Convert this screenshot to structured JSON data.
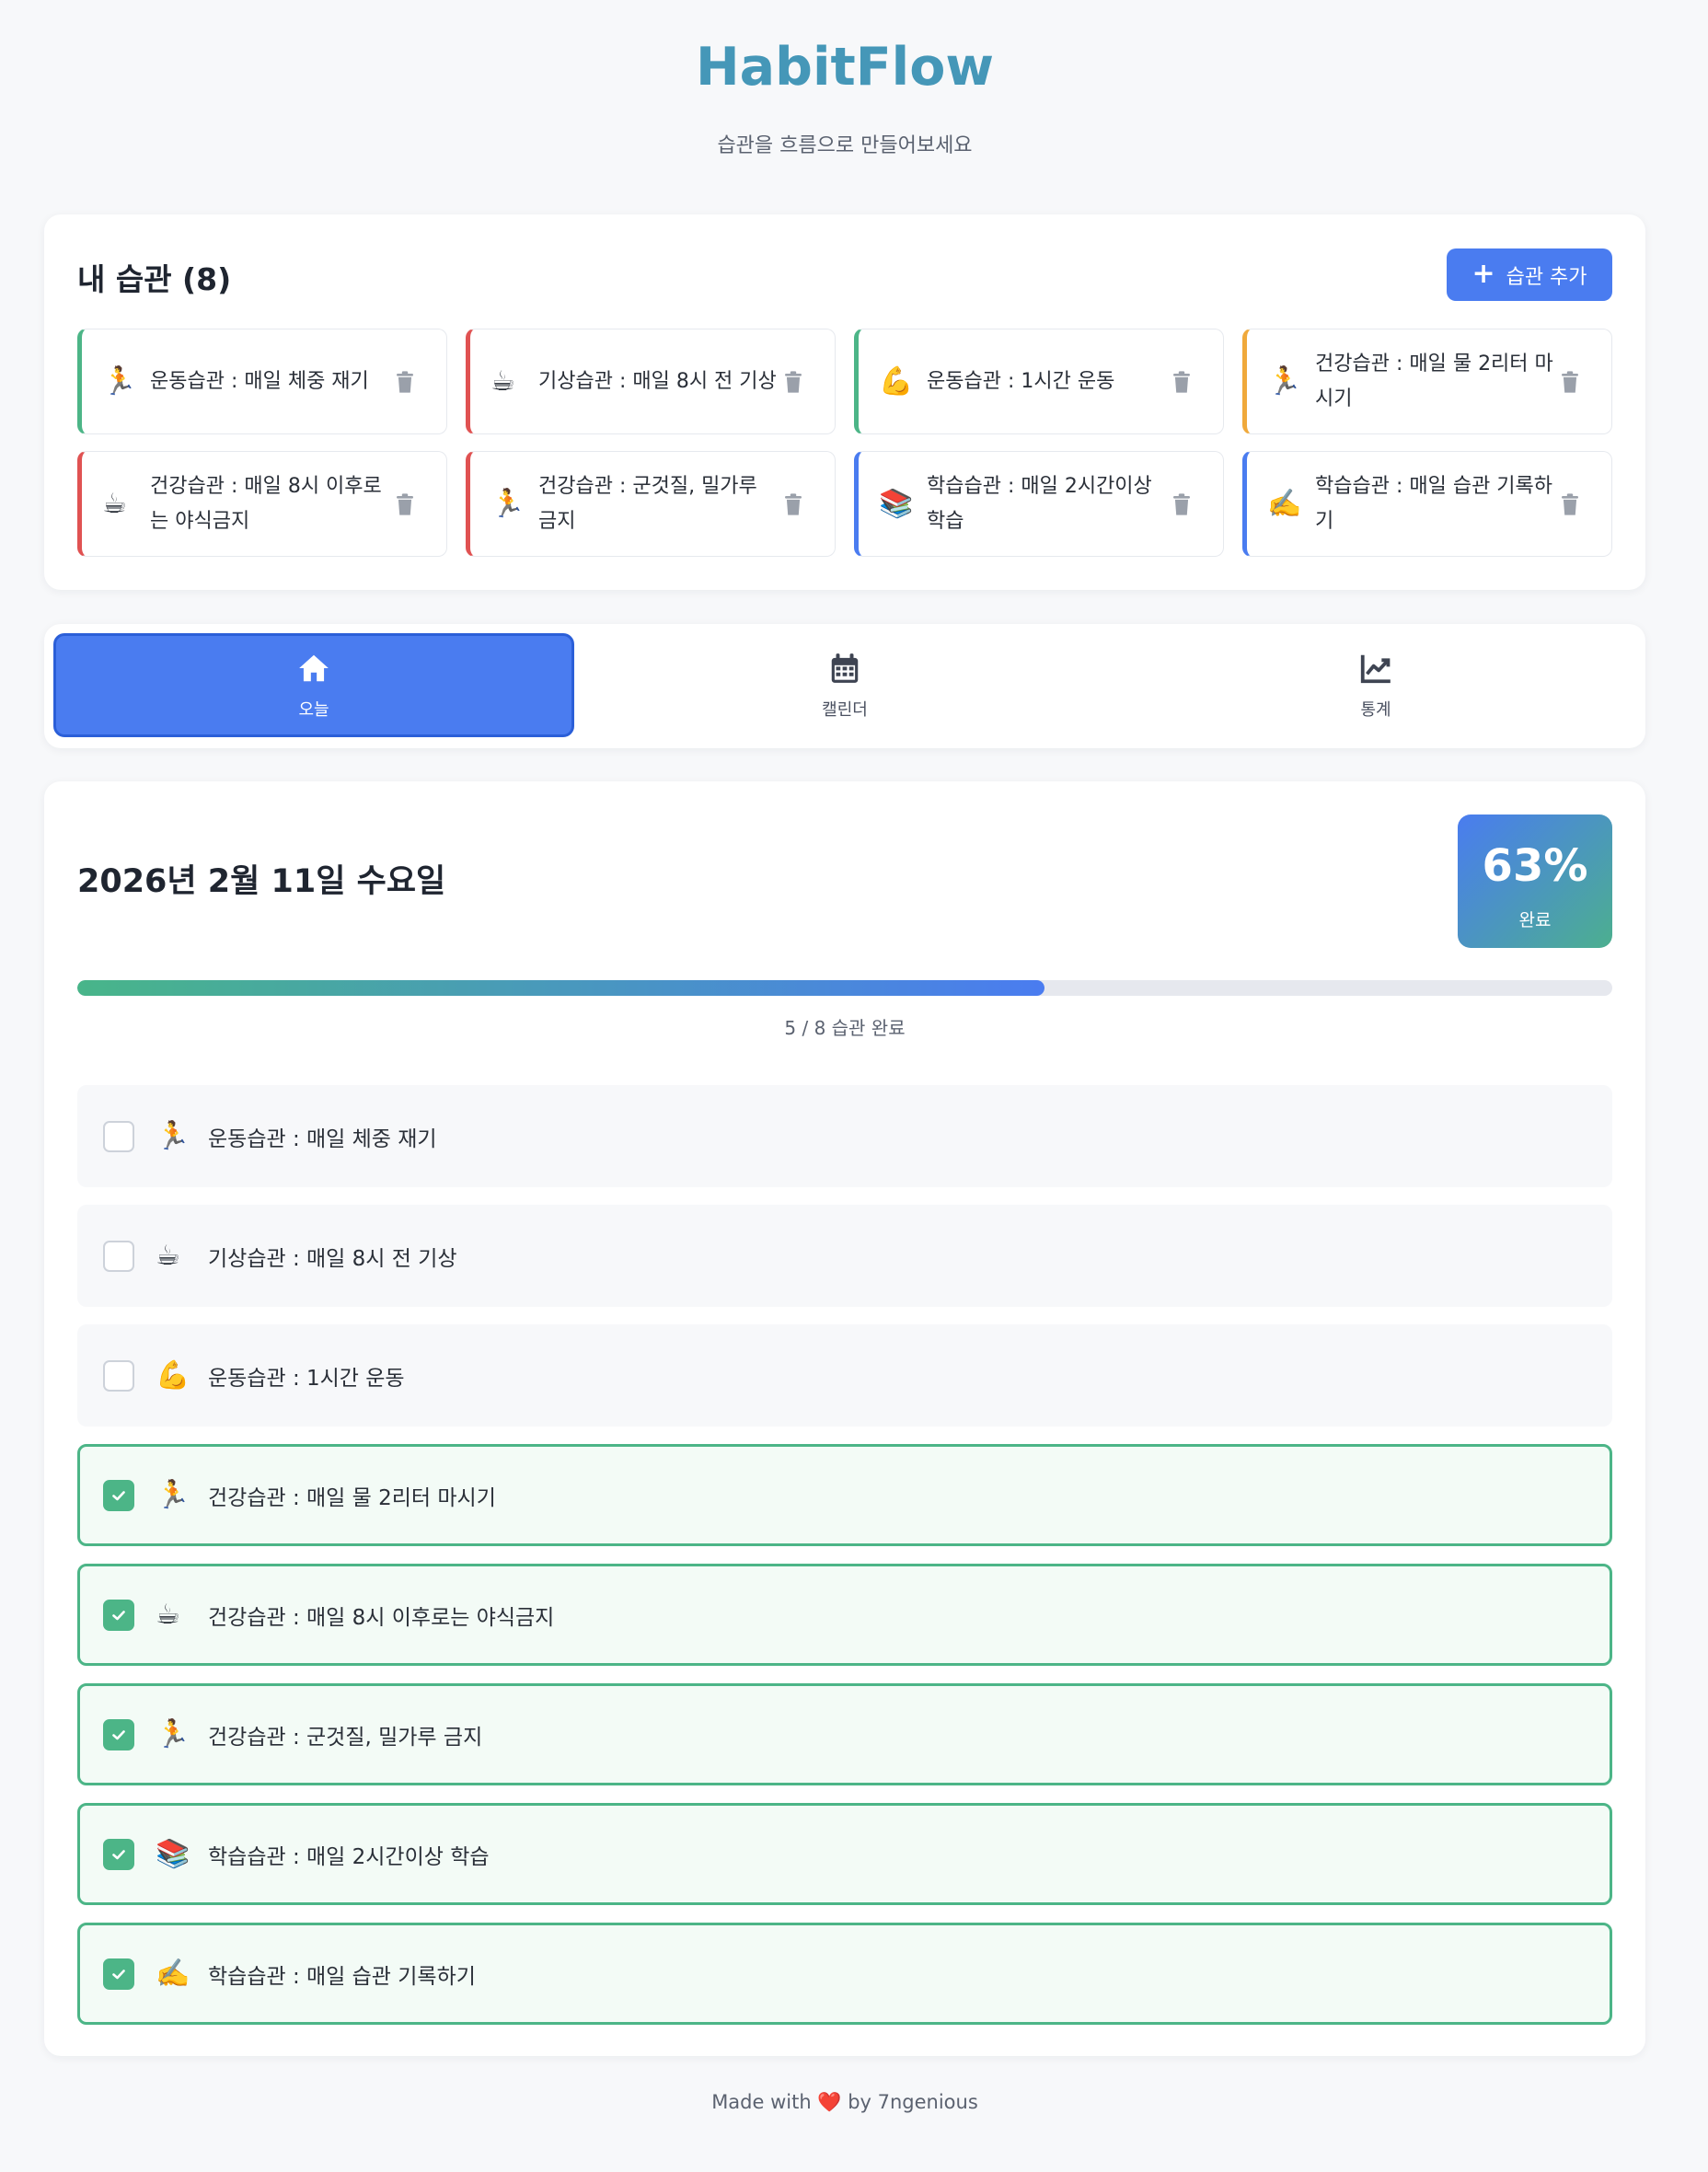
{
  "app": {
    "title": "HabitFlow",
    "subtitle": "습관을 흐름으로 만들어보세요"
  },
  "habits": {
    "title": "내 습관 (8)",
    "add_label": "습관 추가",
    "items": [
      {
        "emoji": "🏃",
        "name": "운동습관 : 매일 체중 재기",
        "color": "#4cb587"
      },
      {
        "emoji": "☕",
        "name": "기상습관 : 매일 8시 전 기상",
        "color": "#e05252"
      },
      {
        "emoji": "💪",
        "name": "운동습관 : 1시간 운동",
        "color": "#4cb587"
      },
      {
        "emoji": "🏃",
        "name": "건강습관 : 매일 물 2리터 마시기",
        "color": "#f0a93b"
      },
      {
        "emoji": "☕",
        "name": "건강습관 : 매일 8시 이후로는 야식금지",
        "color": "#e05252"
      },
      {
        "emoji": "🏃",
        "name": "건강습관 : 군것질, 밀가루 금지",
        "color": "#e05252"
      },
      {
        "emoji": "📚",
        "name": "학습습관 : 매일 2시간이상 학습",
        "color": "#4a7cf0"
      },
      {
        "emoji": "✍️",
        "name": "학습습관 : 매일 습관 기록하기",
        "color": "#4a7cf0"
      }
    ]
  },
  "tabs": [
    {
      "label": "오늘",
      "icon": "home-icon",
      "active": true
    },
    {
      "label": "캘린더",
      "icon": "calendar-icon",
      "active": false
    },
    {
      "label": "통계",
      "icon": "chart-line-icon",
      "active": false
    }
  ],
  "today": {
    "date": "2026년 2월 11일 수요일",
    "percent_text": "63%",
    "percent_label": "완료",
    "progress": 0.63,
    "progress_text": "5 / 8 습관 완료",
    "items": [
      {
        "emoji": "🏃",
        "name": "운동습관 : 매일 체중 재기",
        "done": false
      },
      {
        "emoji": "☕",
        "name": "기상습관 : 매일 8시 전 기상",
        "done": false
      },
      {
        "emoji": "💪",
        "name": "운동습관 : 1시간 운동",
        "done": false
      },
      {
        "emoji": "🏃",
        "name": "건강습관 : 매일 물 2리터 마시기",
        "done": true
      },
      {
        "emoji": "☕",
        "name": "건강습관 : 매일 8시 이후로는 야식금지",
        "done": true
      },
      {
        "emoji": "🏃",
        "name": "건강습관 : 군것질, 밀가루 금지",
        "done": true
      },
      {
        "emoji": "📚",
        "name": "학습습관 : 매일 2시간이상 학습",
        "done": true
      },
      {
        "emoji": "✍️",
        "name": "학습습관 : 매일 습관 기록하기",
        "done": true
      }
    ]
  },
  "footer": {
    "prefix": "Made with",
    "heart": "❤️",
    "suffix": "by 7ngenious"
  }
}
